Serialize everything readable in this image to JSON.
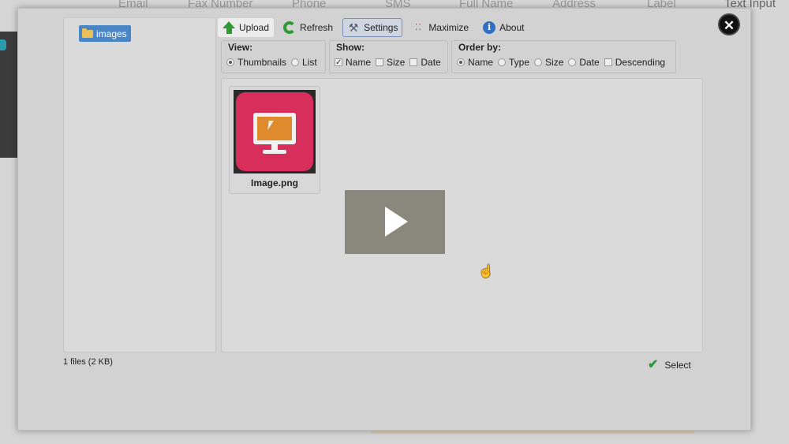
{
  "background": {
    "columns": [
      "Email",
      "Fax Number",
      "Phone",
      "SMS",
      "Full Name",
      "Address",
      "Label",
      "Text Input"
    ]
  },
  "sidebar": {
    "folder_label": "images"
  },
  "toolbar": {
    "upload": "Upload",
    "refresh": "Refresh",
    "settings": "Settings",
    "maximize": "Maximize",
    "about": "About"
  },
  "view": {
    "title": "View:",
    "options": [
      "Thumbnails",
      "List"
    ],
    "selected": "Thumbnails"
  },
  "show": {
    "title": "Show:",
    "options": [
      "Name",
      "Size",
      "Date"
    ],
    "checked": [
      "Name"
    ]
  },
  "order": {
    "title": "Order by:",
    "options": [
      "Name",
      "Type",
      "Size",
      "Date"
    ],
    "selected": "Name",
    "descending_label": "Descending"
  },
  "files": [
    {
      "name": "Image.png"
    }
  ],
  "status": {
    "summary": "1 files (2 KB)"
  },
  "actions": {
    "select": "Select"
  },
  "colors": {
    "accent": "#4a86c5",
    "success": "#2f9a33",
    "thumb_bg": "#d72e5c"
  }
}
